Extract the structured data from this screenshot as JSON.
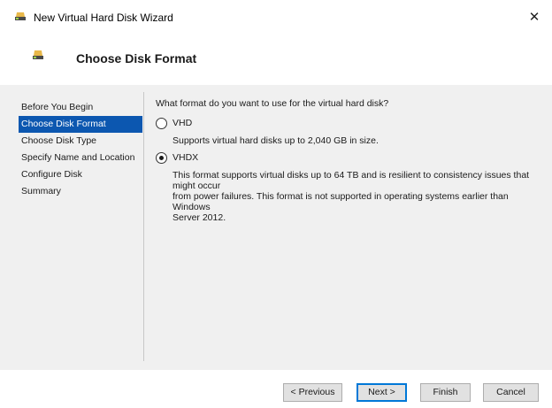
{
  "window": {
    "title": "New Virtual Hard Disk Wizard",
    "close_glyph": "✕"
  },
  "header": {
    "title": "Choose Disk Format"
  },
  "nav": {
    "items": [
      {
        "label": "Before You Begin",
        "active": false
      },
      {
        "label": "Choose Disk Format",
        "active": true
      },
      {
        "label": "Choose Disk Type",
        "active": false
      },
      {
        "label": "Specify Name and Location",
        "active": false
      },
      {
        "label": "Configure Disk",
        "active": false
      },
      {
        "label": "Summary",
        "active": false
      }
    ]
  },
  "content": {
    "question": "What format do you want to use for the virtual hard disk?",
    "options": [
      {
        "label": "VHD",
        "selected": false,
        "description": "Supports virtual hard disks up to 2,040 GB in size."
      },
      {
        "label": "VHDX",
        "selected": true,
        "description_lines": [
          "This format supports virtual disks up to 64 TB and is resilient to consistency issues that might occur",
          "from power failures. This format is not supported in operating systems earlier than Windows",
          "Server 2012."
        ]
      }
    ]
  },
  "buttons": {
    "previous": "< Previous",
    "next": "Next >",
    "finish": "Finish",
    "cancel": "Cancel"
  },
  "icons": {
    "window_icon": "disk-icon",
    "header_icon": "disk-icon"
  },
  "colors": {
    "nav_active_bg": "#0c57b0",
    "body_bg": "#f0f0f0",
    "default_button_border": "#0078d7"
  }
}
